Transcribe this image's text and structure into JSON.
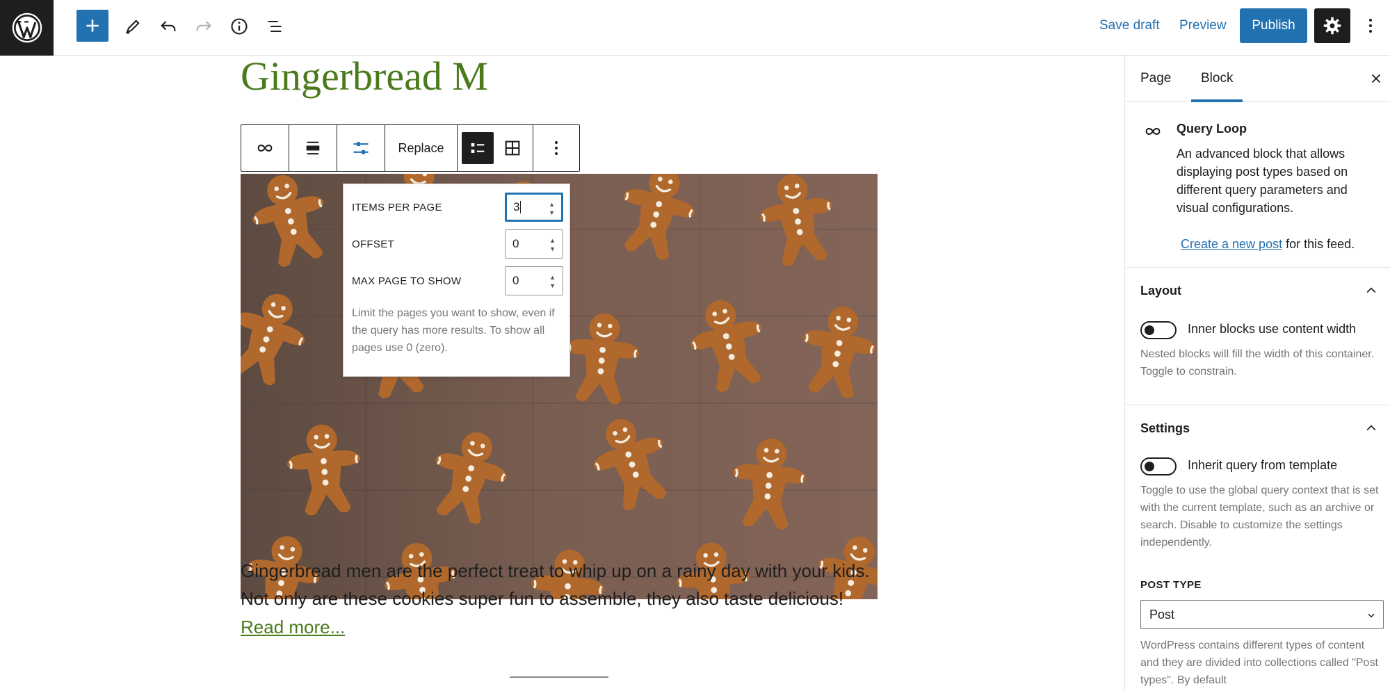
{
  "topbar": {
    "save_draft": "Save draft",
    "preview": "Preview",
    "publish": "Publish",
    "accent": "#2271b1"
  },
  "toolbar": {
    "replace_label": "Replace",
    "icons": [
      "query-loop-icon",
      "align-icon",
      "display-settings-icon",
      "list-view-icon",
      "grid-view-icon",
      "more-options-icon"
    ]
  },
  "post": {
    "title": "Gingerbread M",
    "excerpt": "Gingerbread men are the perfect treat to whip up on a rainy day with your kids. Not only are these cookies super fun to assemble, they also taste delicious!",
    "read_more": "Read more..."
  },
  "popover": {
    "items_per_page_label": "ITEMS PER PAGE",
    "items_per_page_value": "3",
    "offset_label": "OFFSET",
    "offset_value": "0",
    "max_page_label": "MAX PAGE TO SHOW",
    "max_page_value": "0",
    "help": "Limit the pages you want to show, even if the query has more results. To show all pages use 0 (zero)."
  },
  "sidebar": {
    "tabs": [
      {
        "label": "Page"
      },
      {
        "label": "Block"
      }
    ],
    "block_card": {
      "title": "Query Loop",
      "description": "An advanced block that allows displaying post types based on different query parameters and visual configurations.",
      "link_text": "Create a new post",
      "link_suffix": " for this feed."
    },
    "layout": {
      "title": "Layout",
      "toggle_label": "Inner blocks use content width",
      "help": "Nested blocks will fill the width of this container. Toggle to constrain."
    },
    "settings": {
      "title": "Settings",
      "toggle_label": "Inherit query from template",
      "help": "Toggle to use the global query context that is set with the current template, such as an archive or search. Disable to customize the settings independently.",
      "post_type_label": "POST TYPE",
      "post_type_value": "Post",
      "post_type_help": "WordPress contains different types of content and they are divided into collections called \"Post types\". By default"
    }
  }
}
